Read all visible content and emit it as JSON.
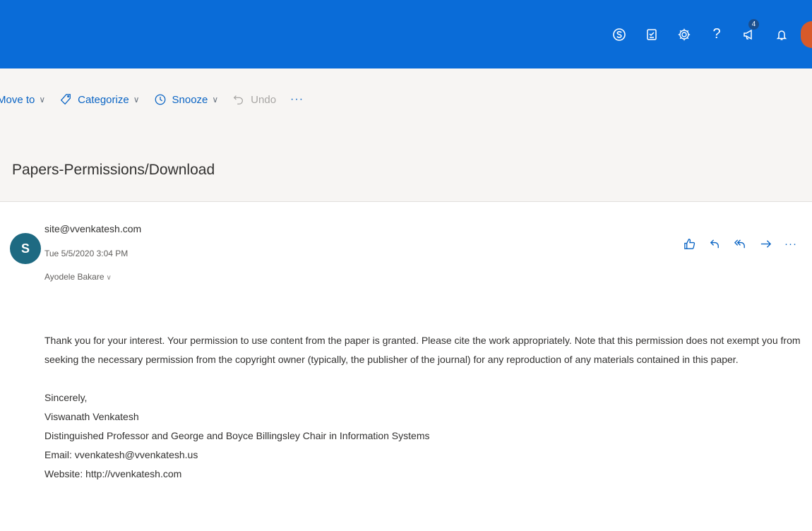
{
  "topbar": {
    "accent_color": "#0a6cd8",
    "icons": [
      {
        "name": "skype-icon"
      },
      {
        "name": "tasks-icon"
      },
      {
        "name": "settings-gear-icon"
      },
      {
        "name": "help-icon",
        "glyph": "?"
      },
      {
        "name": "megaphone-icon",
        "badge": "4"
      },
      {
        "name": "bell-icon"
      }
    ]
  },
  "commandbar": {
    "move_to": "Move to",
    "categorize": "Categorize",
    "snooze": "Snooze",
    "undo": "Undo",
    "more": "···"
  },
  "message": {
    "subject": "Papers-Permissions/Download",
    "avatar_initial": "S",
    "from": "site@vvenkatesh.com",
    "date": "Tue 5/5/2020 3:04 PM",
    "to": "Ayodele Bakare",
    "actions_more": "···",
    "body": {
      "paragraph": "Thank you for your interest. Your permission to use content from the paper is granted. Please cite the work appropriately. Note that this permission does not exempt you from seeking the necessary permission from the copyright owner (typically, the publisher of the journal) for any reproduction of any materials contained in this paper.",
      "signature": [
        "Sincerely,",
        "Viswanath Venkatesh",
        "Distinguished Professor and George and Boyce Billingsley Chair in Information Systems",
        "Email: vvenkatesh@vvenkatesh.us",
        "Website: http://vvenkatesh.com"
      ]
    }
  }
}
